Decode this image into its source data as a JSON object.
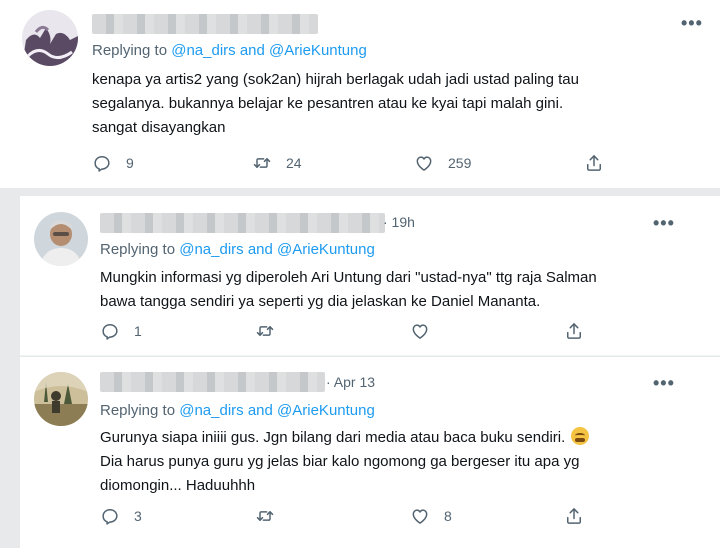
{
  "tweets": [
    {
      "time": "",
      "replying_label": "Replying to ",
      "handle1": "@na_dirs",
      "and_label": " and ",
      "handle2": "@ArieKuntung",
      "lines": [
        "kenapa ya artis2 yang (sok2an) hijrah berlagak udah jadi ustad paling tau",
        "segalanya. bukannya belajar ke pesantren atau ke kyai tapi malah gini.",
        "sangat disayangkan"
      ],
      "replies": "9",
      "retweets": "24",
      "likes": "259"
    },
    {
      "time": "· 19h",
      "replying_label": "Replying to ",
      "handle1": "@na_dirs",
      "and_label": " and ",
      "handle2": "@ArieKuntung",
      "lines": [
        "Mungkin informasi yg diperoleh Ari Untung dari \"ustad-nya\" ttg raja Salman",
        "bawa tangga sendiri ya seperti yg dia jelaskan ke Daniel Mananta."
      ],
      "replies": "1",
      "retweets": "",
      "likes": ""
    },
    {
      "time": "· Apr 13",
      "replying_label": "Replying to ",
      "handle1": "@na_dirs",
      "and_label": " and ",
      "handle2": "@ArieKuntung",
      "lines": [
        "Gurunya siapa iniiii gus. Jgn bilang dari media atau baca buku sendiri.",
        "Dia harus punya guru yg jelas biar kalo ngomong ga bergeser itu apa yg",
        "diomongin... Haduuhhh"
      ],
      "emoji": "loudly-crying-face",
      "replies": "3",
      "retweets": "",
      "likes": "8"
    }
  ],
  "icons": {
    "reply": "reply-icon",
    "retweet": "retweet-icon",
    "like": "like-icon",
    "share": "share-icon",
    "more": "more-icon"
  },
  "colors": {
    "link": "#1d9bf0",
    "secondary_text": "#536471",
    "primary_text": "#0f1419"
  },
  "more_label": "•••"
}
